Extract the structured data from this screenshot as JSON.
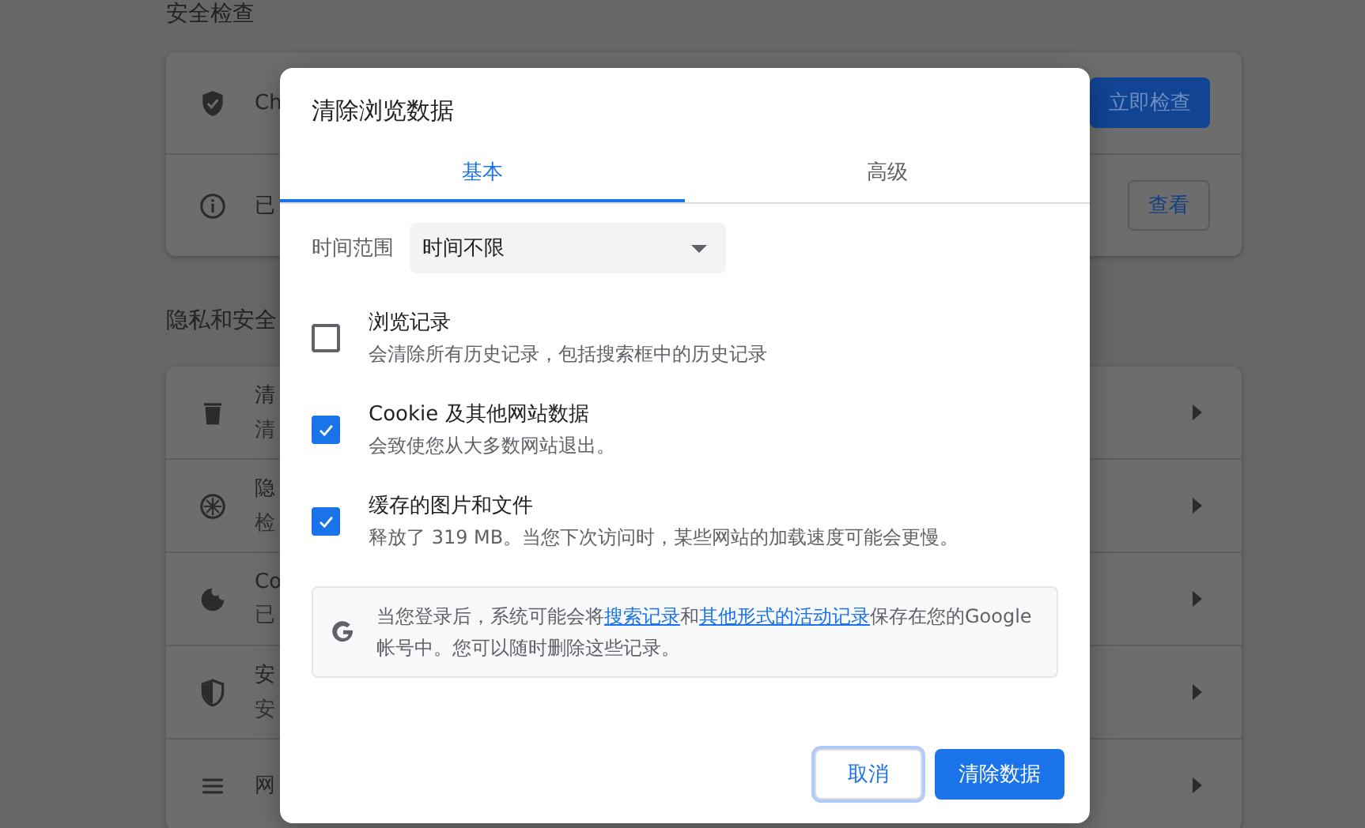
{
  "settings": {
    "sections": [
      {
        "heading": "安全检查",
        "rows": [
          {
            "title": "Ch",
            "button": {
              "label": "立即检查",
              "kind": "primary"
            }
          },
          {
            "title": "已",
            "button": {
              "label": "查看",
              "kind": "outlined"
            }
          }
        ]
      },
      {
        "heading": "隐私和安全",
        "rows": [
          {
            "title": "清",
            "subtitle": "清"
          },
          {
            "title": "隐",
            "subtitle": "检"
          },
          {
            "title": "Co",
            "subtitle": "已"
          },
          {
            "title": "安",
            "subtitle": "安"
          },
          {
            "title": "网"
          }
        ]
      }
    ]
  },
  "dialog": {
    "title": "清除浏览数据",
    "tabs": [
      {
        "label": "基本",
        "selected": true
      },
      {
        "label": "高级",
        "selected": false
      }
    ],
    "time_range": {
      "label": "时间范围",
      "value": "时间不限"
    },
    "options": [
      {
        "title": "浏览记录",
        "description": "会清除所有历史记录，包括搜索框中的历史记录",
        "checked": false
      },
      {
        "title": "Cookie 及其他网站数据",
        "description": "会致使您从大多数网站退出。",
        "checked": true
      },
      {
        "title": "缓存的图片和文件",
        "description": "释放了 319 MB。当您下次访问时，某些网站的加载速度可能会更慢。",
        "checked": true
      }
    ],
    "info": [
      {
        "text": "当您登录后，系统可能会将",
        "kind": "text"
      },
      {
        "text": "搜索记录",
        "kind": "link"
      },
      {
        "text": "和",
        "kind": "text"
      },
      {
        "text": "其他形式的活动记录",
        "kind": "link"
      },
      {
        "text": "保存在您的Google 帐号中。您可以随时删除这些记录。",
        "kind": "text"
      }
    ],
    "buttons": [
      {
        "label": "取消",
        "kind": "secondary",
        "focused": true
      },
      {
        "label": "清除数据",
        "kind": "primary",
        "focused": false
      }
    ]
  }
}
